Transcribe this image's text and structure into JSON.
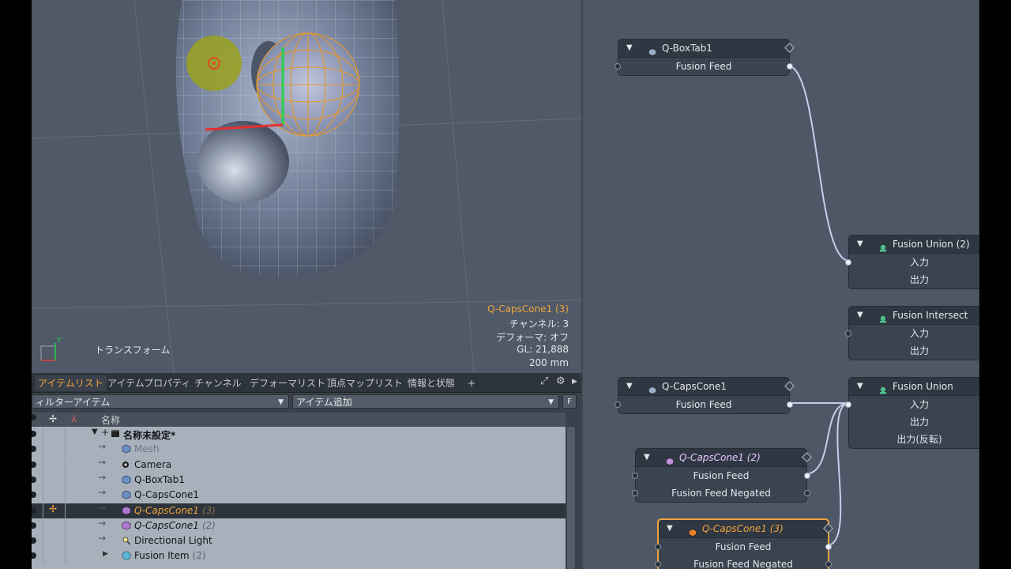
{
  "viewport": {
    "mode_label": "トランスフォーム",
    "info_lines": [
      {
        "text": "Q-CapsCone1 (3)",
        "color": "#f0a43a"
      },
      {
        "text": "チャンネル: 3",
        "color": "#e4e7ea"
      },
      {
        "text": "デフォーマ: オフ",
        "color": "#e4e7ea"
      },
      {
        "text": "GL: 21,888",
        "color": "#e4e7ea"
      },
      {
        "text": "200 mm",
        "color": "#e4e7ea"
      }
    ],
    "axis_y_label": "Y"
  },
  "panel": {
    "tabs": [
      "アイテムリスト",
      "アイテムプロパティ",
      "チャンネル",
      "デフォーマリスト",
      "頂点マップリスト",
      "情報と状態"
    ],
    "tab_add": "+",
    "filter_dropdown": "ィルターアイテム",
    "add_item_dropdown": "アイテム追加",
    "f_button": "F",
    "column_name": "名称",
    "tree": [
      {
        "label": "名称未設定*",
        "suffix": "",
        "icon": "scene-icon",
        "kind": "root"
      },
      {
        "label": "Mesh",
        "suffix": "",
        "icon": "mesh-icon",
        "kind": "dim"
      },
      {
        "label": "Camera",
        "suffix": "",
        "icon": "camera-icon",
        "kind": "normal"
      },
      {
        "label": "Q-BoxTab1",
        "suffix": "",
        "icon": "mesh-icon",
        "kind": "normal"
      },
      {
        "label": "Q-CapsCone1",
        "suffix": "",
        "icon": "mesh-icon",
        "kind": "normal"
      },
      {
        "label": "Q-CapsCone1",
        "suffix": "(3)",
        "icon": "mesh-purple-icon",
        "kind": "selected"
      },
      {
        "label": "Q-CapsCone1",
        "suffix": "(2)",
        "icon": "mesh-purple-icon",
        "kind": "ital"
      },
      {
        "label": "Directional Light",
        "suffix": "",
        "icon": "light-icon",
        "kind": "normal"
      },
      {
        "label": "Fusion Item",
        "suffix": "(2)",
        "icon": "fusion-icon",
        "kind": "normal"
      }
    ]
  },
  "schematic": {
    "nodes": [
      {
        "title": "Q-BoxTab1",
        "ports": [
          "Fusion Feed"
        ],
        "icon": "mesh-icon"
      },
      {
        "title": "Fusion Union (2)",
        "ports": [
          "入力",
          "出力"
        ],
        "icon": "fusion-icon"
      },
      {
        "title": "Fusion Intersect",
        "ports": [
          "入力",
          "出力"
        ],
        "icon": "fusion-icon"
      },
      {
        "title": "Q-CapsCone1",
        "ports": [
          "Fusion Feed"
        ],
        "icon": "mesh-icon"
      },
      {
        "title": "Fusion Union",
        "ports": [
          "入力",
          "出力",
          "出力(反転)"
        ],
        "icon": "fusion-icon"
      },
      {
        "title": "Q-CapsCone1 (2)",
        "ports": [
          "Fusion Feed",
          "Fusion Feed Negated"
        ],
        "icon": "mesh-purple-icon"
      },
      {
        "title": "Q-CapsCone1 (3)",
        "ports": [
          "Fusion Feed",
          "Fusion Feed Negated"
        ],
        "icon": "mesh-orange-icon"
      }
    ]
  },
  "colors": {
    "accent": "#f0a43a",
    "wire": "#c8ccea",
    "fusion_icon": "#4fc08a"
  }
}
